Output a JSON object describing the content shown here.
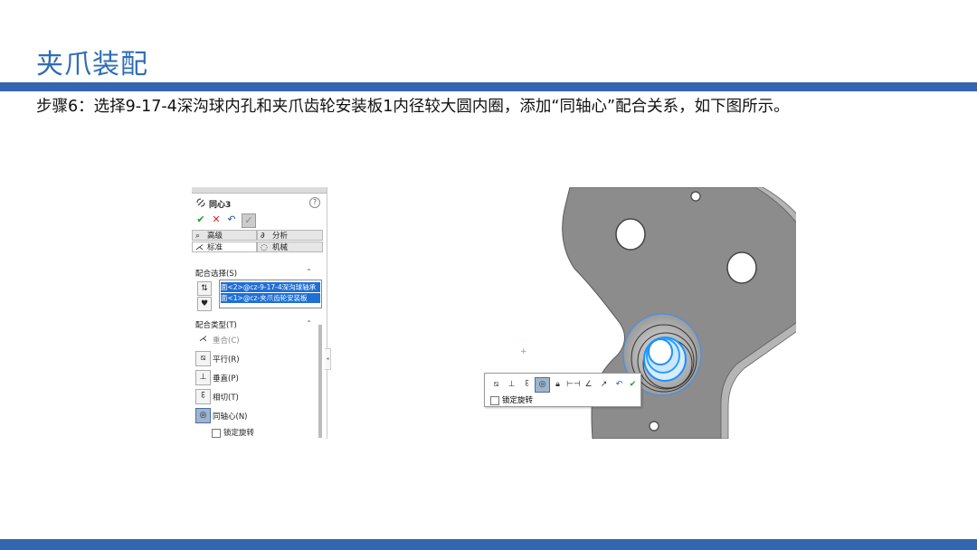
{
  "slide": {
    "title": "夹爪装配",
    "step_text": "步骤6：选择9-17-4深沟球内孔和夹爪齿轮安装板1内径较大圆内圈，添加“同轴心”配合关系，如下图所示。"
  },
  "property_manager": {
    "title": "同心3",
    "help_label": "?",
    "tabs": [
      {
        "label": "高级",
        "icon": "advanced-icon"
      },
      {
        "label": "分析",
        "icon": "analysis-icon"
      },
      {
        "label": "标准",
        "icon": "standard-icon"
      },
      {
        "label": "机械",
        "icon": "mechanical-icon"
      }
    ],
    "selection_section": "配合选择(S)",
    "selections": [
      "面<2>@cz-9-17-4深沟球轴承",
      "面<1>@cz-夹爪齿轮安装板"
    ],
    "mate_type_section": "配合类型(T)",
    "mate_types": [
      {
        "label": "重合(C)",
        "icon": "coincident-icon"
      },
      {
        "label": "平行(R)",
        "icon": "parallel-icon"
      },
      {
        "label": "垂直(P)",
        "icon": "perpendicular-icon"
      },
      {
        "label": "相切(T)",
        "icon": "tangent-icon"
      },
      {
        "label": "同轴心(N)",
        "icon": "concentric-icon"
      }
    ],
    "lock_rotation": "锁定旋转"
  },
  "context_toolbar": {
    "buttons": [
      "parallel-icon",
      "perpendicular-icon",
      "tangent-icon",
      "concentric-icon",
      "lock-icon",
      "distance-icon",
      "angle-icon",
      "flip-icon",
      "undo-icon",
      "ok-icon"
    ],
    "lock_rotation": "锁定旋转"
  },
  "colors": {
    "title_blue": "#2f6db5",
    "bar_blue": "#3466b0",
    "selection_blue": "#1f6fd6",
    "part_gray": "#8a8a8a"
  }
}
